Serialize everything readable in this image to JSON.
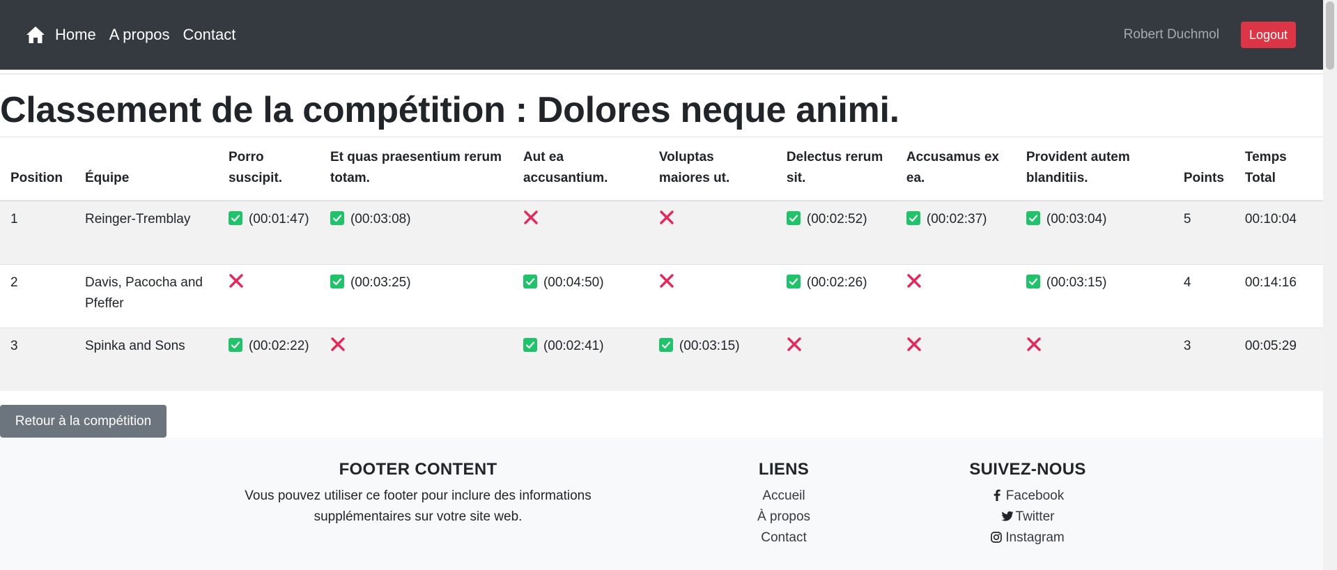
{
  "navbar": {
    "home_icon": "home-icon",
    "links": [
      "Home",
      "A propos",
      "Contact"
    ],
    "user_name": "Robert Duchmol",
    "logout_label": "Logout"
  },
  "page": {
    "title": "Classement de la compétition : Dolores neque animi."
  },
  "table": {
    "headers": {
      "position": "Position",
      "team": "Équipe",
      "q1": "Porro suscipit.",
      "q2": "Et quas praesentium rerum totam.",
      "q3": "Aut ea accusantium.",
      "q4": "Voluptas maiores ut.",
      "q5": "Delectus rerum sit.",
      "q6": "Accusamus ex ea.",
      "q7": "Provident autem blanditiis.",
      "points": "Points",
      "total": "Temps Total"
    },
    "rows": [
      {
        "position": "1",
        "team": "Reinger-Tremblay",
        "results": [
          {
            "status": "success",
            "time": "(00:01:47)"
          },
          {
            "status": "success",
            "time": "(00:03:08)"
          },
          {
            "status": "fail",
            "time": ""
          },
          {
            "status": "fail",
            "time": ""
          },
          {
            "status": "success",
            "time": "(00:02:52)"
          },
          {
            "status": "success",
            "time": "(00:02:37)"
          },
          {
            "status": "success",
            "time": "(00:03:04)"
          }
        ],
        "points": "5",
        "total": "00:10:04"
      },
      {
        "position": "2",
        "team": "Davis, Pacocha and Pfeffer",
        "results": [
          {
            "status": "fail",
            "time": ""
          },
          {
            "status": "success",
            "time": "(00:03:25)"
          },
          {
            "status": "success",
            "time": "(00:04:50)"
          },
          {
            "status": "fail",
            "time": ""
          },
          {
            "status": "success",
            "time": "(00:02:26)"
          },
          {
            "status": "fail",
            "time": ""
          },
          {
            "status": "success",
            "time": "(00:03:15)"
          }
        ],
        "points": "4",
        "total": "00:14:16"
      },
      {
        "position": "3",
        "team": "Spinka and Sons",
        "results": [
          {
            "status": "success",
            "time": "(00:02:22)"
          },
          {
            "status": "fail",
            "time": ""
          },
          {
            "status": "success",
            "time": "(00:02:41)"
          },
          {
            "status": "success",
            "time": "(00:03:15)"
          },
          {
            "status": "fail",
            "time": ""
          },
          {
            "status": "fail",
            "time": ""
          },
          {
            "status": "fail",
            "time": ""
          }
        ],
        "points": "3",
        "total": "00:05:29"
      }
    ]
  },
  "back_button_label": "Retour à la compétition",
  "footer": {
    "content_title": "FOOTER CONTENT",
    "content_text_line1": "Vous pouvez utiliser ce footer pour inclure des informations",
    "content_text_line2": "supplémentaires sur votre site web.",
    "links_title": "LIENS",
    "links": [
      "Accueil",
      "À propos",
      "Contact"
    ],
    "social_title": "SUIVEZ-NOUS",
    "social": [
      {
        "label": "Facebook",
        "icon": "facebook-icon"
      },
      {
        "label": "Twitter",
        "icon": "twitter-icon"
      },
      {
        "label": "Instagram",
        "icon": "instagram-icon"
      }
    ]
  },
  "colors": {
    "navbar": "#343a40",
    "logout": "#dc3545",
    "success": "#20c36a",
    "fail": "#e8265a",
    "secondary": "#6c757d"
  }
}
